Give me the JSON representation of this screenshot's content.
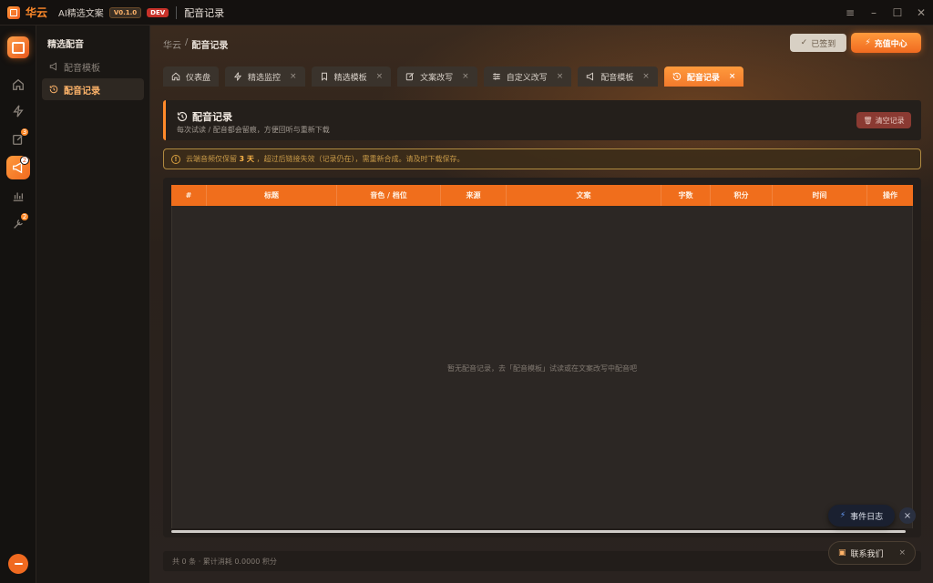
{
  "titlebar": {
    "brand": "华云",
    "app_name": "AI精选文案",
    "version": "V0.1.0",
    "env": "DEV",
    "page": "配音记录"
  },
  "rail": {
    "items": [
      {
        "icon": "home-icon",
        "badge": ""
      },
      {
        "icon": "bolt-icon",
        "badge": ""
      },
      {
        "icon": "edit-icon",
        "badge": "3"
      },
      {
        "icon": "megaphone-icon",
        "badge": "2",
        "active": true
      },
      {
        "icon": "chart-icon",
        "badge": ""
      },
      {
        "icon": "tools-icon",
        "badge": "2"
      }
    ]
  },
  "subnav": {
    "title": "精选配音",
    "items": [
      {
        "label": "配音模板"
      },
      {
        "label": "配音记录"
      }
    ]
  },
  "breadcrumb": {
    "root": "华云",
    "sep": "/",
    "current": "配音记录"
  },
  "actions": {
    "signed": "已签到",
    "recharge": "充值中心"
  },
  "tabs": [
    {
      "label": "仪表盘",
      "closable": false
    },
    {
      "label": "精选监控",
      "closable": true
    },
    {
      "label": "精选模板",
      "closable": true
    },
    {
      "label": "文案改写",
      "closable": true
    },
    {
      "label": "自定义改写",
      "closable": true
    },
    {
      "label": "配音模板",
      "closable": true
    },
    {
      "label": "配音记录",
      "closable": true,
      "active": true
    }
  ],
  "tab_close": "×",
  "header": {
    "title": "配音记录",
    "subtitle": "每次试读 / 配音都会留痕，方便回听与重新下载",
    "clear_button": "清空记录"
  },
  "notice": {
    "icon": "!",
    "prefix": "云端音频仅保留",
    "highlight": "3 天",
    "suffix": "，超过后链接失效（记录仍在），需重新合成。请及时下载保存。"
  },
  "table": {
    "columns": [
      "#",
      "标题",
      "音色 / 档位",
      "来源",
      "文案",
      "字数",
      "积分",
      "时间",
      "操作"
    ],
    "rows": [],
    "empty_text": "暂无配音记录，去「配音模板」试读或在文案改写中配音吧"
  },
  "footer": {
    "summary": "共 0 条 · 累计消耗 0.0000 积分"
  },
  "float": {
    "event_log": "事件日志",
    "close": "×",
    "contact": "联系我们",
    "contact_close": "×"
  },
  "colors": {
    "accent": "#f06e1c",
    "accent_light": "#ff9a3c",
    "bg": "#1a1613"
  }
}
